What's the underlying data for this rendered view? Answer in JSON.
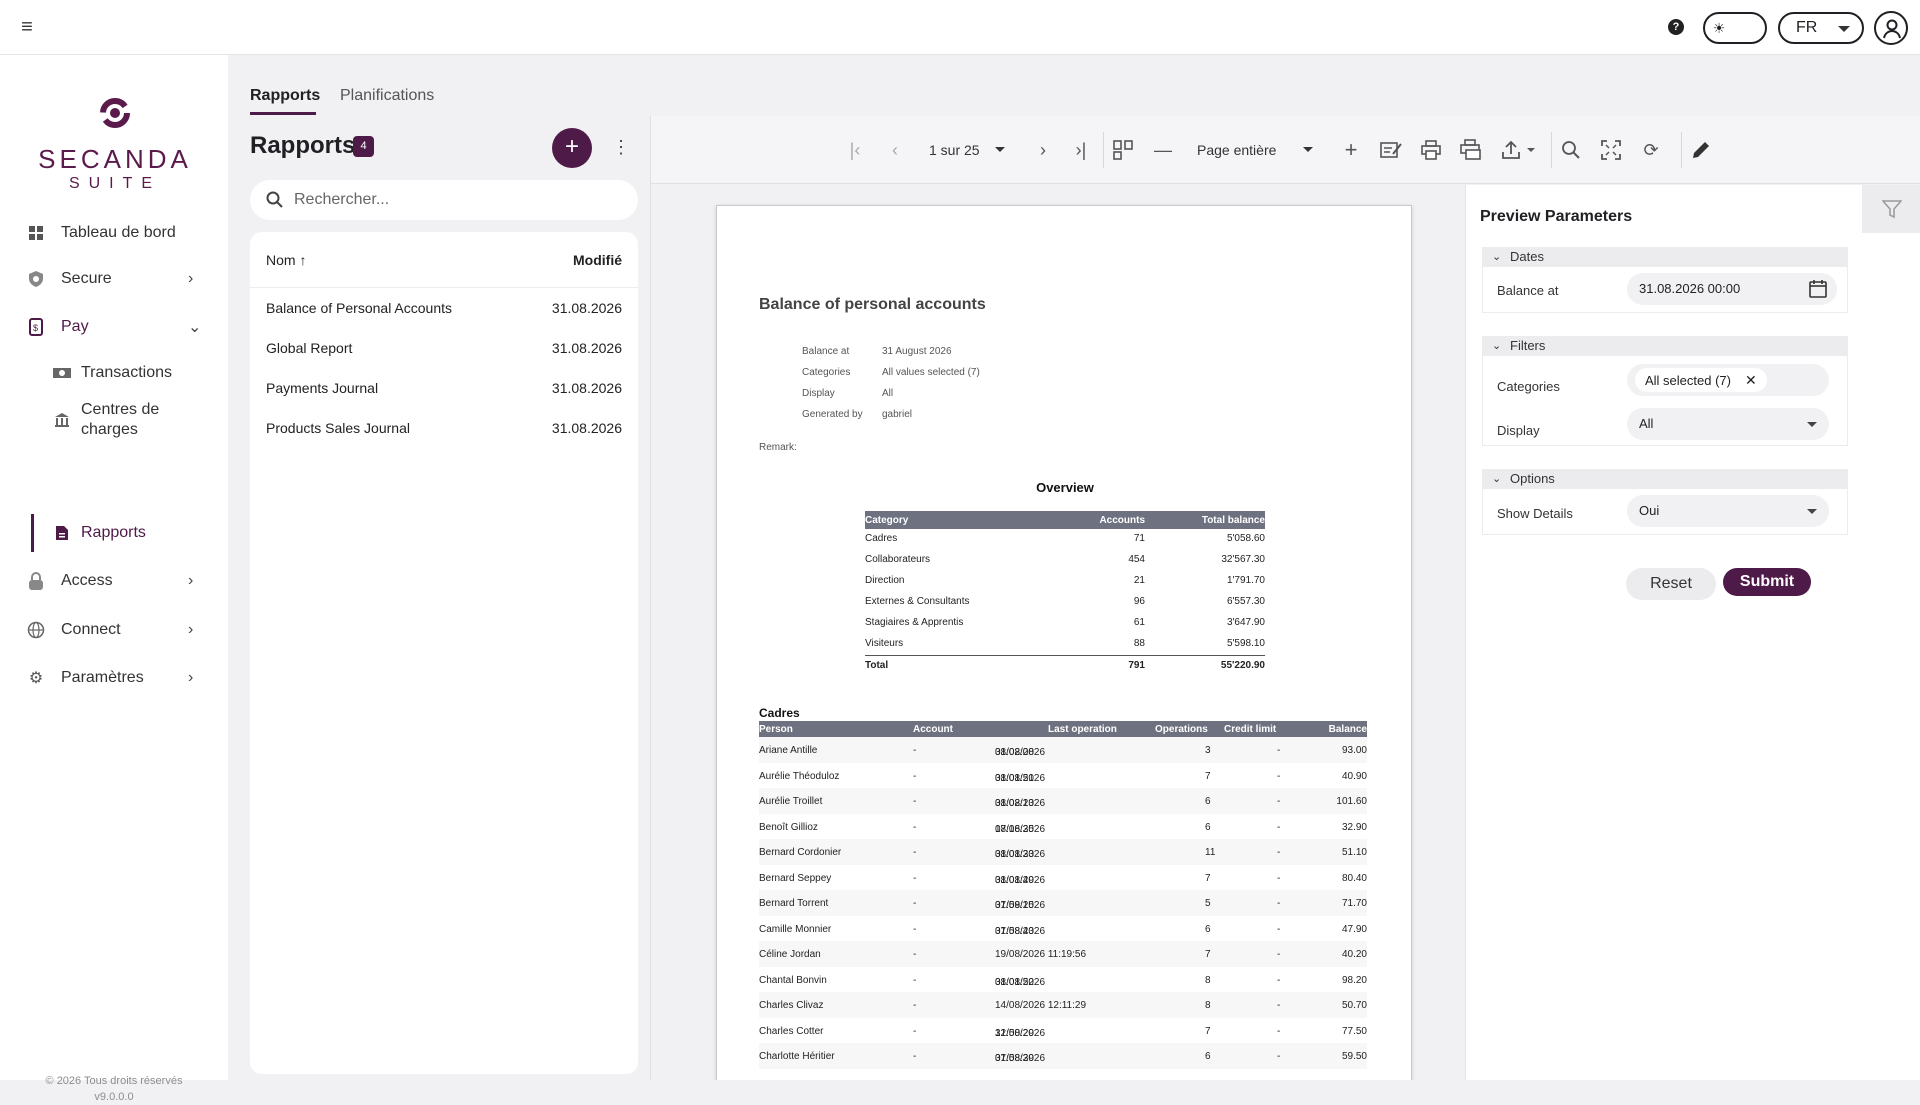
{
  "header": {
    "language": "FR",
    "help_label": "?"
  },
  "brand": {
    "name": "SECANDA",
    "suite": "SUITE",
    "color": "#5b1a4c"
  },
  "sidebar": {
    "items": [
      {
        "label": "Tableau de bord",
        "icon": "dashboard-icon"
      },
      {
        "label": "Secure",
        "icon": "shield-icon"
      },
      {
        "label": "Pay",
        "icon": "pay-card-icon"
      },
      {
        "label": "Transactions",
        "icon": "money-icon"
      },
      {
        "label": "Centres de charges",
        "icon": "bank-icon"
      },
      {
        "label": "Rapports",
        "icon": "report-icon"
      },
      {
        "label": "Access",
        "icon": "lock-icon"
      },
      {
        "label": "Connect",
        "icon": "globe-icon"
      },
      {
        "label": "Paramètres",
        "icon": "gear-icon"
      }
    ],
    "footer_copyright": "© 2026 Tous droits réservés",
    "footer_version": "v9.0.0.0"
  },
  "tabs": [
    {
      "label": "Rapports"
    },
    {
      "label": "Planifications"
    }
  ],
  "reports": {
    "title": "Rapports",
    "count": "4",
    "add_label": "+",
    "search_placeholder": "Rechercher...",
    "col_name": "Nom ↑",
    "col_modified": "Modifié",
    "rows": [
      {
        "name": "Balance of Personal Accounts",
        "date": "31.08.2026"
      },
      {
        "name": "Global Report",
        "date": "31.08.2026"
      },
      {
        "name": "Payments Journal",
        "date": "31.08.2026"
      },
      {
        "name": "Products Sales Journal",
        "date": "31.08.2026"
      }
    ]
  },
  "viewer": {
    "page_indicator": "1 sur 25",
    "zoom": "Page entière"
  },
  "document": {
    "title": "Balance of personal accounts",
    "meta": [
      {
        "k": "Balance at",
        "v": "31 August 2026"
      },
      {
        "k": "Categories",
        "v": "All values selected (7)"
      },
      {
        "k": "Display",
        "v": "All"
      },
      {
        "k": "Generated by",
        "v": "gabriel"
      }
    ],
    "remark": "Remark:",
    "overview_title": "Overview",
    "overview_headers": [
      "Category",
      "Accounts",
      "Total balance"
    ],
    "overview_rows": [
      [
        "Cadres",
        "71",
        "5'058.60"
      ],
      [
        "Collaborateurs",
        "454",
        "32'567.30"
      ],
      [
        "Direction",
        "21",
        "1'791.70"
      ],
      [
        "Externes & Consultants",
        "96",
        "6'557.30"
      ],
      [
        "Stagiaires & Apprentis",
        "61",
        "3'647.90"
      ],
      [
        "Visiteurs",
        "88",
        "5'598.10"
      ]
    ],
    "overview_total": [
      "Total",
      "791",
      "55'220.90"
    ],
    "section_title": "Cadres",
    "cadres_headers": [
      "Person",
      "Account",
      "Last operation",
      "Operations",
      "Credit limit",
      "Balance"
    ],
    "cadres_rows": [
      [
        "Ariane Antille",
        "-",
        "31/08/2026",
        "08:02:08",
        "3",
        "-",
        "93.00"
      ],
      [
        "Aurélie Théoduloz",
        "-",
        "31/08/2026",
        "08:01:51",
        "7",
        "-",
        "40.90"
      ],
      [
        "Aurélie Troillet",
        "-",
        "31/08/2026",
        "08:02:13",
        "6",
        "-",
        "101.60"
      ],
      [
        "Benoît Gillioz",
        "-",
        "18/08/2026",
        "07:16:35",
        "6",
        "-",
        "32.90"
      ],
      [
        "Bernard Cordonier",
        "-",
        "31/08/2026",
        "08:01:33",
        "11",
        "-",
        "51.10"
      ],
      [
        "Bernard Seppey",
        "-",
        "31/08/2026",
        "08:01:49",
        "7",
        "-",
        "80.40"
      ],
      [
        "Bernard Torrent",
        "-",
        "31/08/2026",
        "07:59:15",
        "5",
        "-",
        "71.70"
      ],
      [
        "Camille Monnier",
        "-",
        "31/08/2026",
        "07:58:43",
        "6",
        "-",
        "47.90"
      ],
      [
        "Céline Jordan",
        "-",
        "19/08/2026 11:19:56",
        "",
        "7",
        "-",
        "40.20"
      ],
      [
        "Chantal Bonvin",
        "-",
        "31/08/2026",
        "08:01:52",
        "8",
        "-",
        "98.20"
      ],
      [
        "Charles Clivaz",
        "-",
        "14/08/2026 12:11:29",
        "",
        "8",
        "-",
        "50.70"
      ],
      [
        "Charles Cotter",
        "-",
        "31/08/2026",
        "12:50:29",
        "7",
        "-",
        "77.50"
      ],
      [
        "Charlotte Héritier",
        "-",
        "31/08/2026",
        "07:58:39",
        "6",
        "-",
        "59.50"
      ]
    ]
  },
  "params": {
    "title": "Preview Parameters",
    "group_dates": "Dates",
    "balance_at_label": "Balance at",
    "balance_at_value": "31.08.2026 00:00",
    "group_filters": "Filters",
    "categories_label": "Categories",
    "categories_chip": "All selected (7)",
    "display_label": "Display",
    "display_value": "All",
    "group_options": "Options",
    "show_details_label": "Show Details",
    "show_details_value": "Oui",
    "reset_label": "Reset",
    "submit_label": "Submit"
  }
}
